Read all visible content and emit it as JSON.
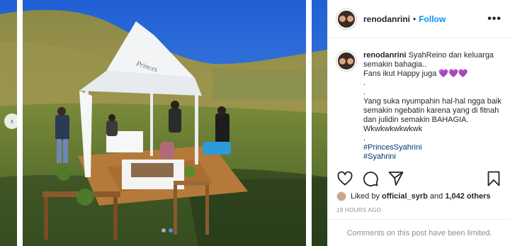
{
  "post": {
    "username": "renodanrini",
    "separator": "•",
    "follow_label": "Follow",
    "more_label": "•••",
    "caption": {
      "username": "renodanrini",
      "line1": "SyahReino dan keluarga semakin bahagia..",
      "line2": "Fans ikut Happy juga",
      "hearts": "💜💜💜",
      "dot1": ".",
      "dot2": ".",
      "body": "Yang suka nyumpahin hal-hal ngga baik semakin ngebatin karena yang di fitnah dan julidin semakin BAHAGIA. Wkwkwkwkwkwk",
      "dot3": ".",
      "hashtag": "#PrincesSyahrini",
      "cut_line": "#Syahrini"
    },
    "likes": {
      "prefix": "Liked by",
      "user": "official_syrb",
      "and": "and",
      "others": "1,042 others"
    },
    "timestamp": "19 HOURS AGO",
    "comments_disabled": "Comments on this post have been limited."
  },
  "carousel": {
    "prev_arrow": "‹",
    "total_slides": 2,
    "active_slide": 2,
    "tent_logo_text": "Princes"
  },
  "colors": {
    "accent": "#0095f6",
    "heart_purple": "#7b4fd6",
    "muted": "#8e8e8e",
    "sky": "#2f6fd8"
  },
  "icons": [
    "heart-icon",
    "comment-icon",
    "share-icon",
    "bookmark-icon",
    "more-icon",
    "chevron-left-icon"
  ]
}
